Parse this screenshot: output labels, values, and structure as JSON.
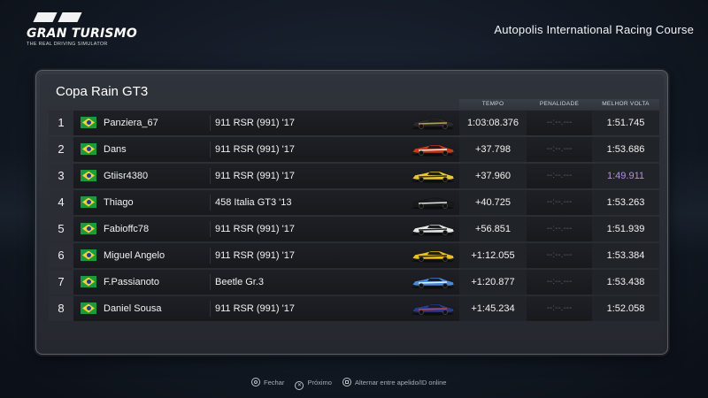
{
  "logo": {
    "main": "GRAN TURISMO",
    "sub": "THE REAL DRIVING SIMULATOR"
  },
  "track": "Autopolis International Racing Course",
  "race_title": "Copa Rain GT3",
  "columns": {
    "tempo": "TEMPO",
    "penalty": "PENALIDADE",
    "best": "MELHOR VOLTA"
  },
  "results": [
    {
      "pos": "1",
      "name": "Panziera_67",
      "car": "911 RSR (991) '17",
      "time": "1:03:08.376",
      "penalty": "--:--.---",
      "best": "1:51.745",
      "car_color": "#2a2a2a",
      "accent": "#c8a030"
    },
    {
      "pos": "2",
      "name": "Dans",
      "car": "911 RSR (991) '17",
      "time": "+37.798",
      "penalty": "--:--.---",
      "best": "1:53.686",
      "car_color": "#c03a1e",
      "accent": "#f0f0f0"
    },
    {
      "pos": "3",
      "name": "Gtiisr4380",
      "car": "911 RSR (991) '17",
      "time": "+37.960",
      "penalty": "--:--.---",
      "best": "1:49.911",
      "car_color": "#e8c830",
      "accent": "#303030",
      "best_purple": true
    },
    {
      "pos": "4",
      "name": "Thiago",
      "car": "458 Italia GT3 '13",
      "time": "+40.725",
      "penalty": "--:--.---",
      "best": "1:53.263",
      "car_color": "#1a1a1a",
      "accent": "#e8e8e8"
    },
    {
      "pos": "5",
      "name": "Fabioffc78",
      "car": "911 RSR (991) '17",
      "time": "+56.851",
      "penalty": "--:--.---",
      "best": "1:51.939",
      "car_color": "#e6e6e6",
      "accent": "#202020"
    },
    {
      "pos": "6",
      "name": "Miguel Angelo",
      "car": "911 RSR (991) '17",
      "time": "+1:12.055",
      "penalty": "--:--.---",
      "best": "1:53.384",
      "car_color": "#e8c020",
      "accent": "#202020"
    },
    {
      "pos": "7",
      "name": "F.Passianoto",
      "car": "Beetle Gr.3",
      "time": "+1:20.877",
      "penalty": "--:--.---",
      "best": "1:53.438",
      "car_color": "#4a8ad8",
      "accent": "#f0f0f0"
    },
    {
      "pos": "8",
      "name": "Daniel Sousa",
      "car": "911 RSR (991) '17",
      "time": "+1:45.234",
      "penalty": "--:--.---",
      "best": "1:52.058",
      "car_color": "#2a3a8a",
      "accent": "#d83a2a"
    }
  ],
  "footer": {
    "close": "Fechar",
    "next": "Próximo",
    "toggle": "Alternar entre apelido/ID online"
  },
  "colors": {
    "purple_best": "#b48ee8",
    "flag_green": "#1e9a3c",
    "flag_yellow": "#f0d43a",
    "flag_blue": "#1f3d8f"
  }
}
